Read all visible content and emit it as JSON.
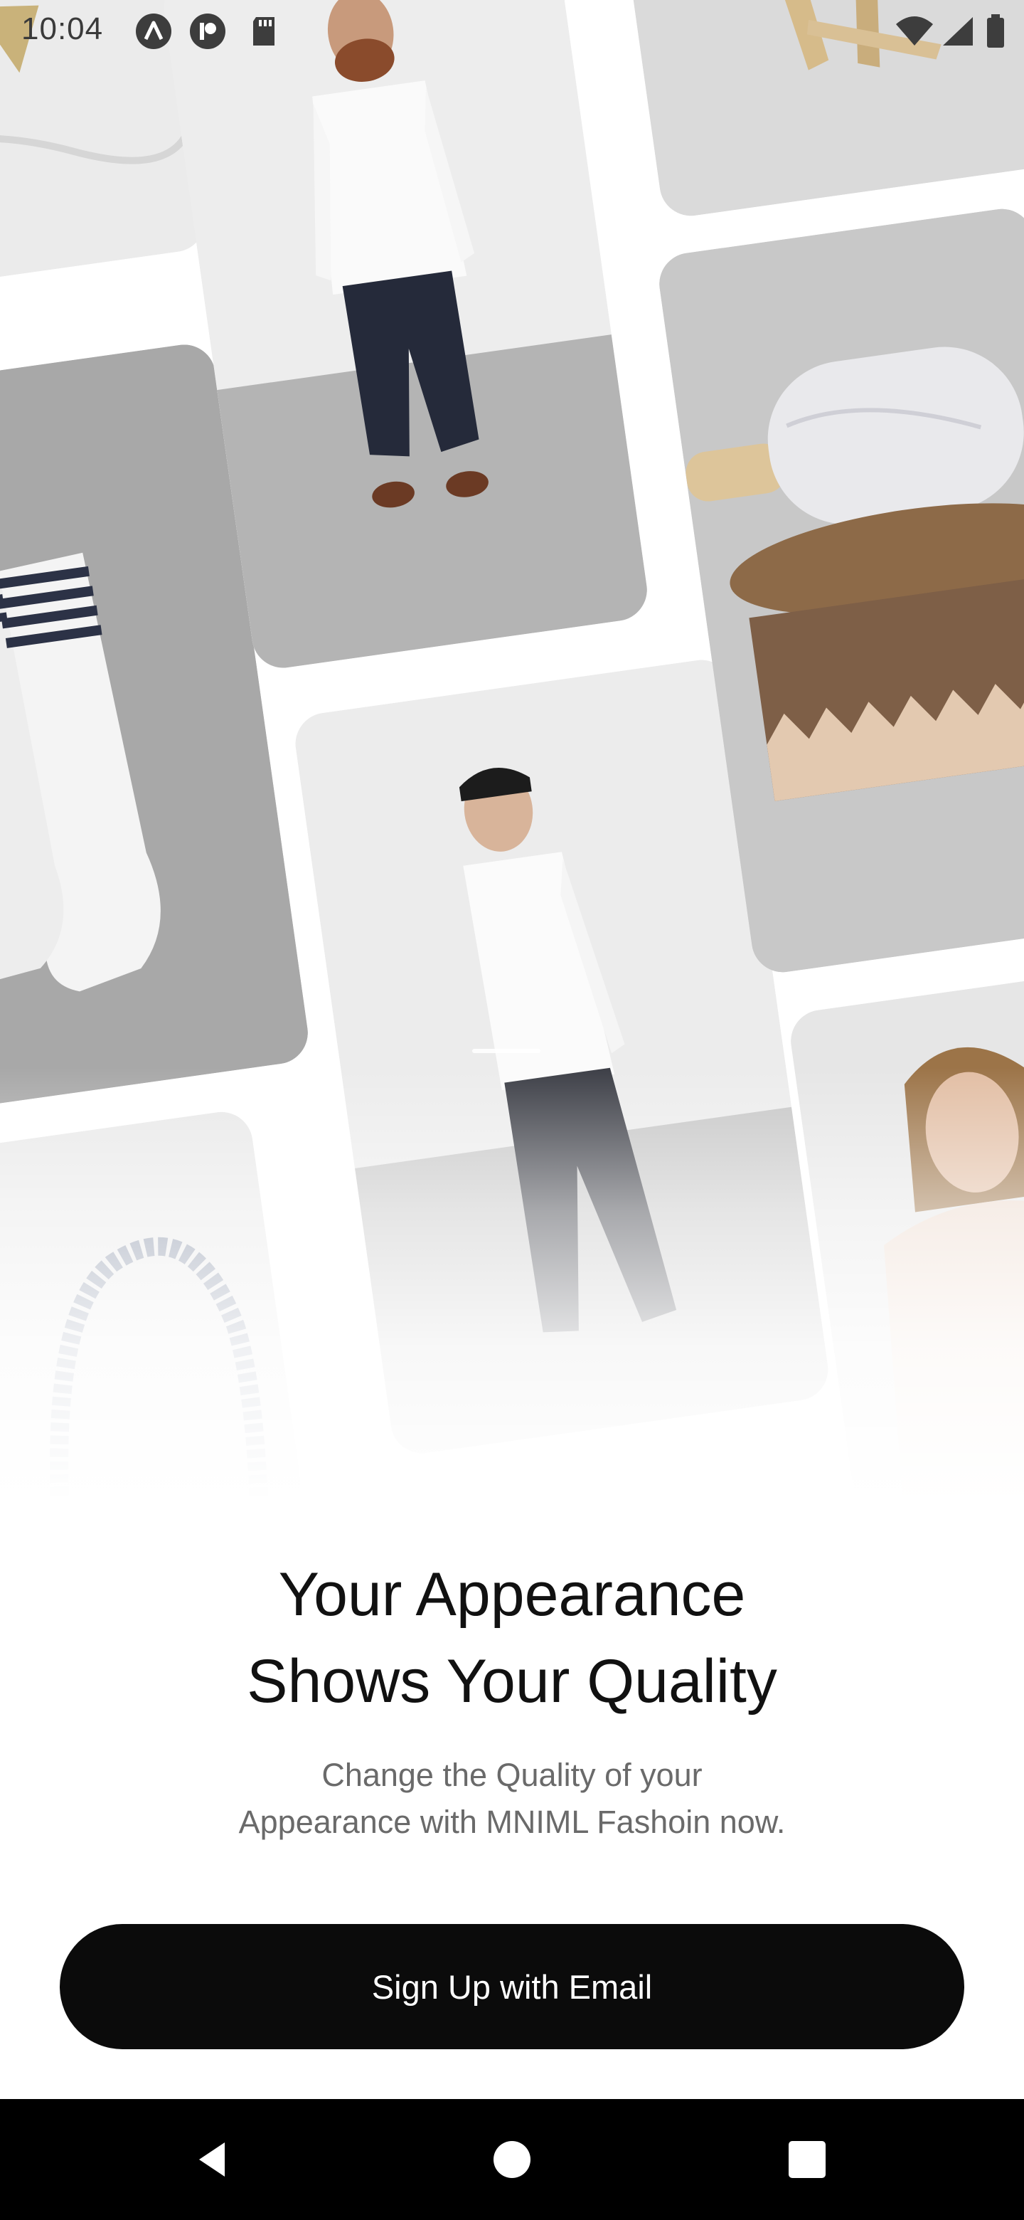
{
  "status_bar": {
    "time": "10:04",
    "icons": [
      "app-a-icon",
      "app-p-icon",
      "sd-card-icon",
      "wifi-icon",
      "signal-icon",
      "battery-icon"
    ]
  },
  "collage": {
    "images": [
      "earrings-image",
      "socks-image",
      "rope-image",
      "man-white-shirt-image",
      "man-walking-image",
      "wooden-stool-image",
      "marble-rolling-pin-image",
      "long-hair-man-image"
    ]
  },
  "onboarding": {
    "headline_line1": "Your Appearance",
    "headline_line2": "Shows Your Quality",
    "subtitle_line1": "Change the Quality of your",
    "subtitle_line2": "Appearance with MNIML Fashoin now.",
    "signup_label": "Sign Up with Email"
  },
  "navigation": {
    "buttons": [
      "back-icon",
      "home-icon",
      "recents-icon"
    ]
  },
  "colors": {
    "button_bg": "#0b0b0b",
    "button_text": "#ffffff",
    "headline": "#111111",
    "subtitle": "#6a6a6a",
    "nav_bar": "#000000"
  }
}
